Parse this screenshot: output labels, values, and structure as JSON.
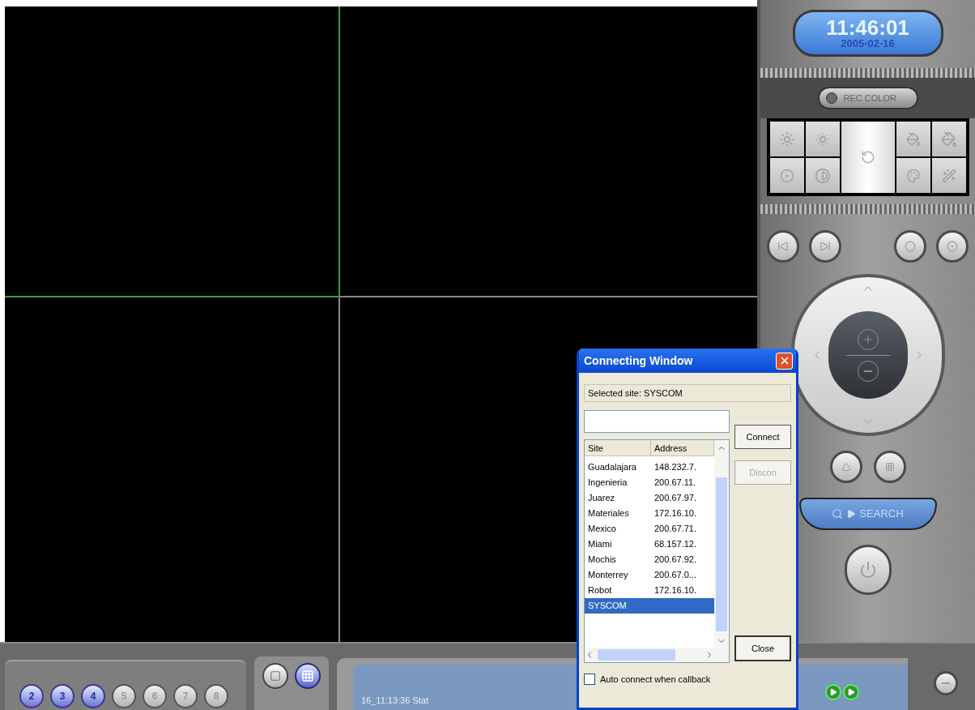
{
  "video_grid": {
    "cells": [
      {
        "selected": true
      },
      {
        "selected": false
      },
      {
        "selected": false
      },
      {
        "selected": false
      }
    ]
  },
  "clock": {
    "time": "11:46:01",
    "date": "2005-02-16"
  },
  "rec_color": {
    "label": "REC COLOR",
    "on": false
  },
  "search_button": {
    "label": "SEARCH"
  },
  "channels": [
    {
      "label": "2",
      "selected": true
    },
    {
      "label": "3",
      "selected": true
    },
    {
      "label": "4",
      "selected": true
    },
    {
      "label": "5",
      "selected": false
    },
    {
      "label": "6",
      "selected": false
    },
    {
      "label": "7",
      "selected": false
    },
    {
      "label": "8",
      "selected": false
    }
  ],
  "layouts": [
    {
      "kind": "single",
      "selected": false
    },
    {
      "kind": "quad",
      "selected": true
    }
  ],
  "status": {
    "log": "16_11:13:36 Stat"
  },
  "dialog": {
    "title": "Connecting Window",
    "selected_site": "Selected site: SYSCOM",
    "connect_button": {
      "label": "Connect",
      "disabled": false
    },
    "disconnect_button": {
      "label": "Discon",
      "disabled": true
    },
    "close_button": "Close",
    "columns": [
      "Site",
      "Address"
    ],
    "rows": [
      {
        "site": "Guadalajara",
        "address": "148.232.7.",
        "selected": false
      },
      {
        "site": "Ingenieria",
        "address": "200.67.11.",
        "selected": false
      },
      {
        "site": "Juarez",
        "address": "200.67.97.",
        "selected": false
      },
      {
        "site": "Materiales",
        "address": "172.16.10.",
        "selected": false
      },
      {
        "site": "Mexico",
        "address": "200.67.71.",
        "selected": false
      },
      {
        "site": "Miami",
        "address": "68.157.12.",
        "selected": false
      },
      {
        "site": "Mochis",
        "address": "200.67.92.",
        "selected": false
      },
      {
        "site": "Monterrey",
        "address": "200.67.0...",
        "selected": false
      },
      {
        "site": "Robot",
        "address": "172.16.10.",
        "selected": false
      },
      {
        "site": "SYSCOM",
        "address": "",
        "selected": true
      }
    ],
    "auto_connect": {
      "label": "Auto connect when callback",
      "checked": false
    }
  }
}
